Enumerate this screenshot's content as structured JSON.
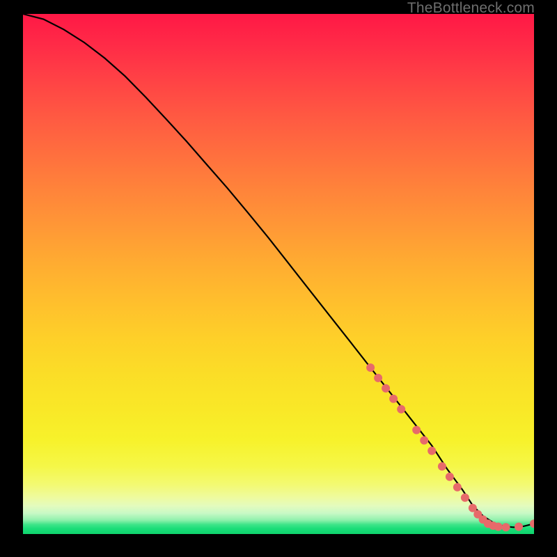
{
  "watermark": "TheBottleneck.com",
  "chart_data": {
    "type": "line",
    "title": "",
    "xlabel": "",
    "ylabel": "",
    "xlim": [
      0,
      100
    ],
    "ylim": [
      0,
      100
    ],
    "grid": false,
    "series": [
      {
        "name": "curve",
        "color": "#000000",
        "x": [
          0,
          4,
          8,
          12,
          16,
          20,
          24,
          28,
          32,
          36,
          40,
          44,
          48,
          52,
          56,
          60,
          64,
          68,
          72,
          76,
          80,
          83,
          86,
          88,
          90,
          92,
          94,
          96,
          98,
          100
        ],
        "y": [
          100,
          99,
          97,
          94.5,
          91.5,
          88,
          84,
          79.8,
          75.5,
          71,
          66.5,
          61.8,
          57,
          52,
          47,
          42,
          37,
          32,
          27,
          22,
          17,
          12.5,
          8.5,
          5.5,
          3.5,
          2.2,
          1.5,
          1.3,
          1.5,
          2.0
        ]
      }
    ],
    "markers": [
      {
        "x": 68.0,
        "y": 32.0
      },
      {
        "x": 69.5,
        "y": 30.0
      },
      {
        "x": 71.0,
        "y": 28.0
      },
      {
        "x": 72.5,
        "y": 26.0
      },
      {
        "x": 74.0,
        "y": 24.0
      },
      {
        "x": 77.0,
        "y": 20.0
      },
      {
        "x": 78.5,
        "y": 18.0
      },
      {
        "x": 80.0,
        "y": 16.0
      },
      {
        "x": 82.0,
        "y": 13.0
      },
      {
        "x": 83.5,
        "y": 11.0
      },
      {
        "x": 85.0,
        "y": 9.0
      },
      {
        "x": 86.5,
        "y": 7.0
      },
      {
        "x": 88.0,
        "y": 5.0
      },
      {
        "x": 89.0,
        "y": 3.8
      },
      {
        "x": 90.0,
        "y": 2.8
      },
      {
        "x": 91.0,
        "y": 2.0
      },
      {
        "x": 92.0,
        "y": 1.6
      },
      {
        "x": 93.0,
        "y": 1.4
      },
      {
        "x": 94.5,
        "y": 1.3
      },
      {
        "x": 97.0,
        "y": 1.4
      },
      {
        "x": 100.0,
        "y": 2.0
      }
    ],
    "marker_style": {
      "color": "#e76a6a",
      "radius_px": 6
    }
  }
}
